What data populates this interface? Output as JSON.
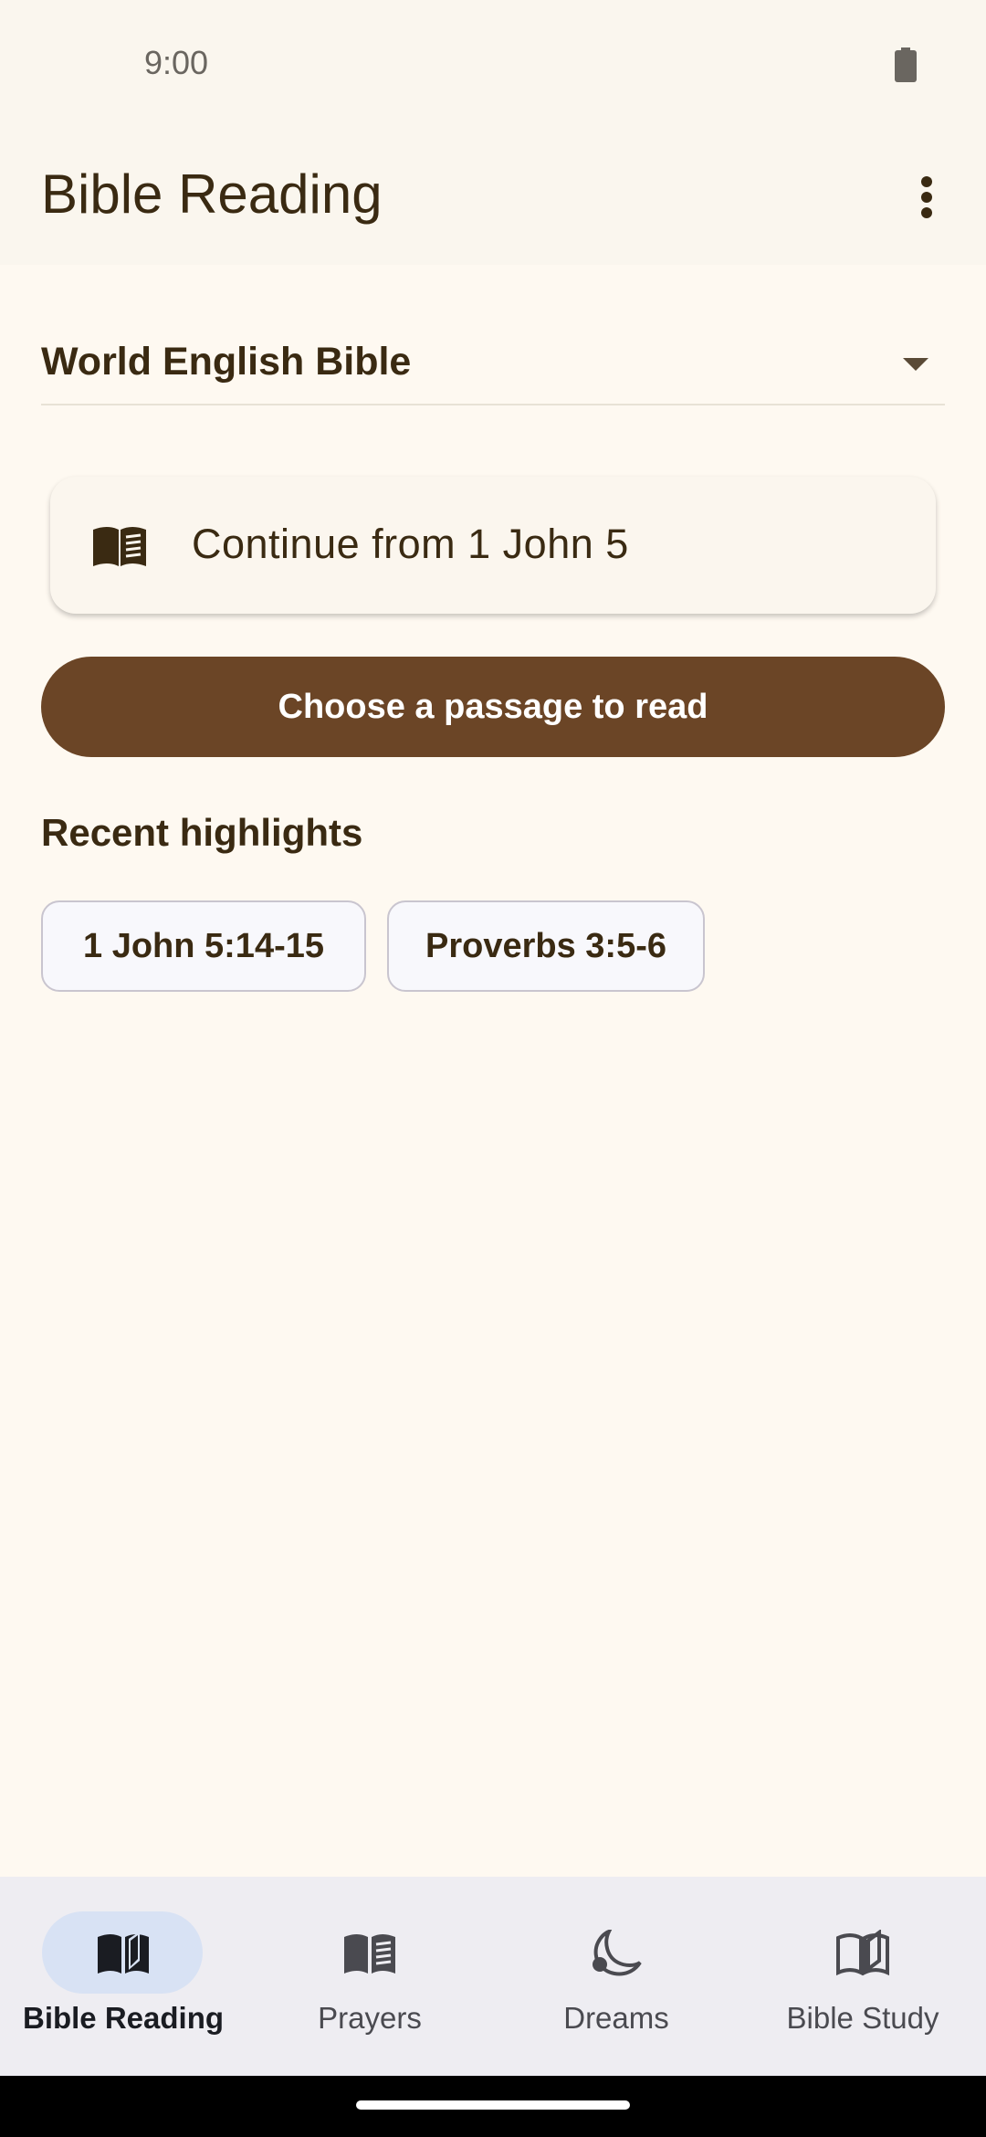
{
  "status_bar": {
    "time": "9:00",
    "battery_icon": "battery-full-icon"
  },
  "app_bar": {
    "title": "Bible Reading",
    "menu_icon": "more-vert-icon"
  },
  "translation_select": {
    "selected": "World English Bible",
    "arrow_icon": "dropdown-arrow-icon"
  },
  "continue_card": {
    "icon": "open-book-icon",
    "label": "Continue from 1 John 5"
  },
  "primary_action": {
    "label": "Choose a passage to read"
  },
  "highlights": {
    "heading": "Recent highlights",
    "chips": [
      "1 John 5:14-15",
      "Proverbs 3:5-6"
    ]
  },
  "bottom_nav": {
    "items": [
      {
        "label": "Bible Reading",
        "icon": "book-open-filled-icon",
        "active": true
      },
      {
        "label": "Prayers",
        "icon": "book-icon",
        "active": false
      },
      {
        "label": "Dreams",
        "icon": "moon-icon",
        "active": false
      },
      {
        "label": "Bible Study",
        "icon": "book-open-outline-icon",
        "active": false
      }
    ]
  },
  "colors": {
    "background": "#FEF9F1",
    "app_bar": "#FAF6EE",
    "text_primary": "#3A2A12",
    "primary_button": "#6B4526",
    "nav_background": "#EEEDF2",
    "nav_indicator": "#D8E2F4"
  }
}
